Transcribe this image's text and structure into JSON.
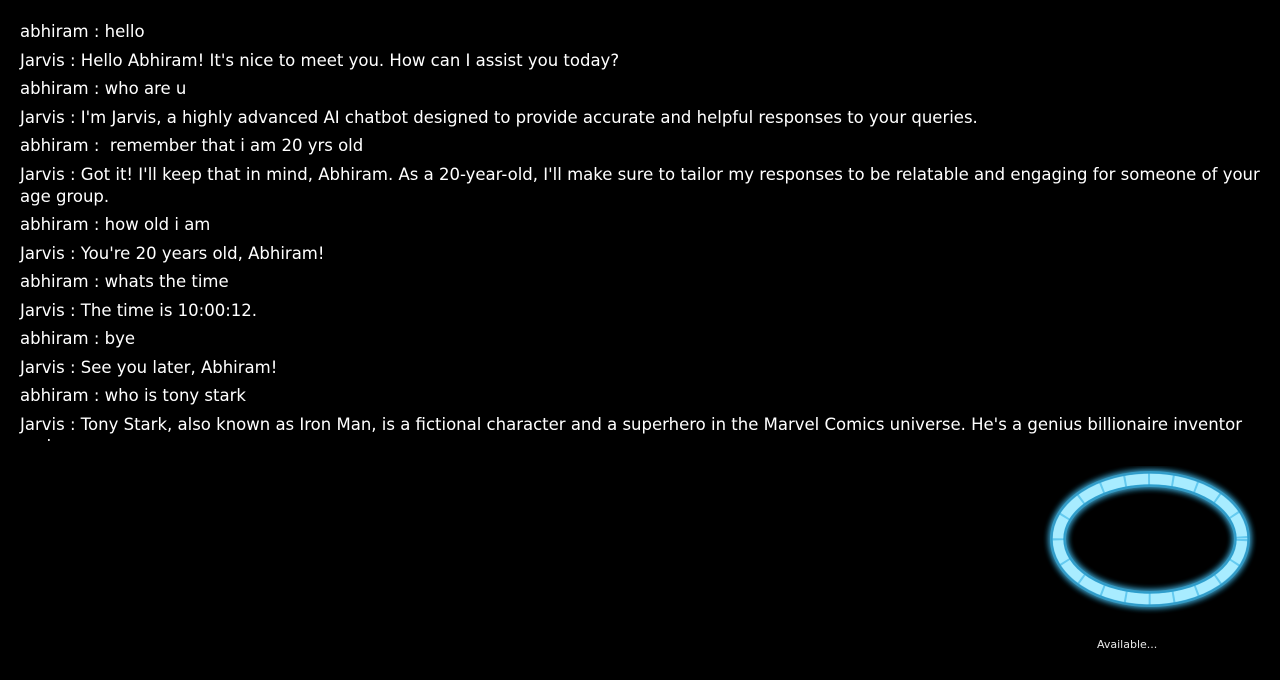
{
  "chat": {
    "messages": [
      {
        "speaker": "abhiram",
        "separator": " : ",
        "text": "hello"
      },
      {
        "speaker": "Jarvis",
        "separator": " : ",
        "text": "Hello Abhiram! It's nice to meet you. How can I assist you today?"
      },
      {
        "speaker": "abhiram",
        "separator": " : ",
        "text": "who are u"
      },
      {
        "speaker": "Jarvis",
        "separator": " : ",
        "text": "I'm Jarvis, a highly advanced AI chatbot designed to provide accurate and helpful responses to your queries."
      },
      {
        "speaker": "abhiram",
        "separator": " : ",
        "text": " remember that i am 20 yrs old"
      },
      {
        "speaker": "Jarvis",
        "separator": " : ",
        "text": "Got it! I'll keep that in mind, Abhiram. As a 20-year-old, I'll make sure to tailor my responses to be relatable and engaging for someone of your age group."
      },
      {
        "speaker": "abhiram",
        "separator": " : ",
        "text": "how old i am"
      },
      {
        "speaker": "Jarvis",
        "separator": " : ",
        "text": "You're 20 years old, Abhiram!"
      },
      {
        "speaker": "abhiram",
        "separator": " : ",
        "text": "whats the time"
      },
      {
        "speaker": "Jarvis",
        "separator": " : ",
        "text": "The time is 10:00:12."
      },
      {
        "speaker": "abhiram",
        "separator": " : ",
        "text": "bye"
      },
      {
        "speaker": "Jarvis",
        "separator": " : ",
        "text": "See you later, Abhiram!"
      },
      {
        "speaker": "abhiram",
        "separator": " : ",
        "text": "who is tony stark"
      },
      {
        "speaker": "Jarvis",
        "separator": " : ",
        "text": "Tony Stark, also known as Iron Man, is a fictional character and a superhero in the Marvel Comics universe. He's a genius billionaire inventor and"
      }
    ]
  },
  "assistant": {
    "icon": "glowing-ring-icon",
    "ring_color": "#6fd6f5",
    "status": "Available..."
  },
  "colors": {
    "background": "#000000",
    "text": "#ffffff"
  }
}
